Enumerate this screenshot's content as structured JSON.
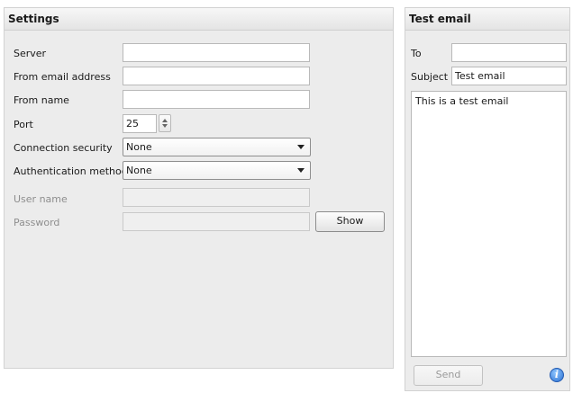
{
  "settings": {
    "title": "Settings",
    "server_label": "Server",
    "server_value": "",
    "from_email_label": "From email address",
    "from_email_value": "",
    "from_name_label": "From name",
    "from_name_value": "",
    "port_label": "Port",
    "port_value": "25",
    "security_label": "Connection security",
    "security_value": "None",
    "auth_label": "Authentication method",
    "auth_value": "None",
    "username_label": "User name",
    "username_value": "",
    "password_label": "Password",
    "password_value": "",
    "show_button": "Show"
  },
  "test_email": {
    "title": "Test email",
    "to_label": "To",
    "to_value": "",
    "subject_label": "Subject",
    "subject_value": "Test email",
    "body": "This is a test email",
    "send_button": "Send",
    "info_icon": "info-icon"
  },
  "colors": {
    "panel_bg": "#ececec",
    "disabled_text": "#8e8e8e",
    "info_blue": "#2a6fd1"
  }
}
